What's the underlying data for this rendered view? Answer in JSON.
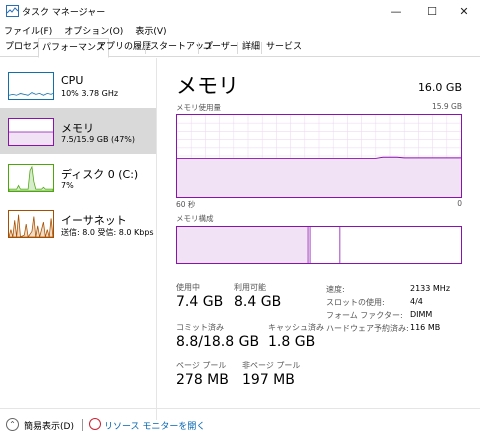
{
  "window": {
    "title": "タスク マネージャー",
    "minimize_glyph": "—",
    "maximize_glyph": "☐",
    "close_glyph": "✕"
  },
  "menu": [
    "ファイル(F)",
    "オプション(O)",
    "表示(V)"
  ],
  "tabs": [
    "プロセス",
    "パフォーマンス",
    "アプリの履歴",
    "スタートアップ",
    "ユーザー",
    "詳細",
    "サービス"
  ],
  "active_tab": "パフォーマンス",
  "sidebar": {
    "items": [
      {
        "name": "CPU",
        "sub": "10% 3.78 GHz",
        "color": "#1170aa",
        "icon": "cpu-graph-icon"
      },
      {
        "name": "メモリ",
        "sub": "7.5/15.9 GB (47%)",
        "color": "#8b12ae",
        "icon": "memory-graph-icon"
      },
      {
        "name": "ディスク 0 (C:)",
        "sub": "7%",
        "color": "#4da60c",
        "icon": "disk-graph-icon"
      },
      {
        "name": "イーサネット",
        "sub": "送信: 8.0 受信: 8.0 Kbps",
        "color": "#a74f01",
        "icon": "ethernet-graph-icon"
      }
    ]
  },
  "main": {
    "title": "メモリ",
    "total": "16.0 GB",
    "usage_label": "メモリ使用量",
    "usage_max": "15.9 GB",
    "axis_left": "60 秒",
    "axis_right": "0",
    "composition_label": "メモリ構成",
    "usage_level": 0.47,
    "stats": {
      "in_use_label": "使用中",
      "in_use": "7.4 GB",
      "available_label": "利用可能",
      "available": "8.4 GB",
      "committed_label": "コミット済み",
      "committed": "8.8/18.8 GB",
      "cached_label": "キャッシュ済み",
      "cached": "1.8 GB",
      "paged_label": "ページ プール",
      "paged": "278 MB",
      "nonpaged_label": "非ページ プール",
      "nonpaged": "197 MB"
    },
    "specs": {
      "speed_label": "速度:",
      "speed": "2133 MHz",
      "slots_label": "スロットの使用:",
      "slots": "4/4",
      "form_label": "フォーム ファクター:",
      "form": "DIMM",
      "reserved_label": "ハードウェア予約済み:",
      "reserved": "116 MB"
    }
  },
  "footer": {
    "fewer": "簡易表示(D)",
    "resmon": "リソース モニターを開く"
  }
}
